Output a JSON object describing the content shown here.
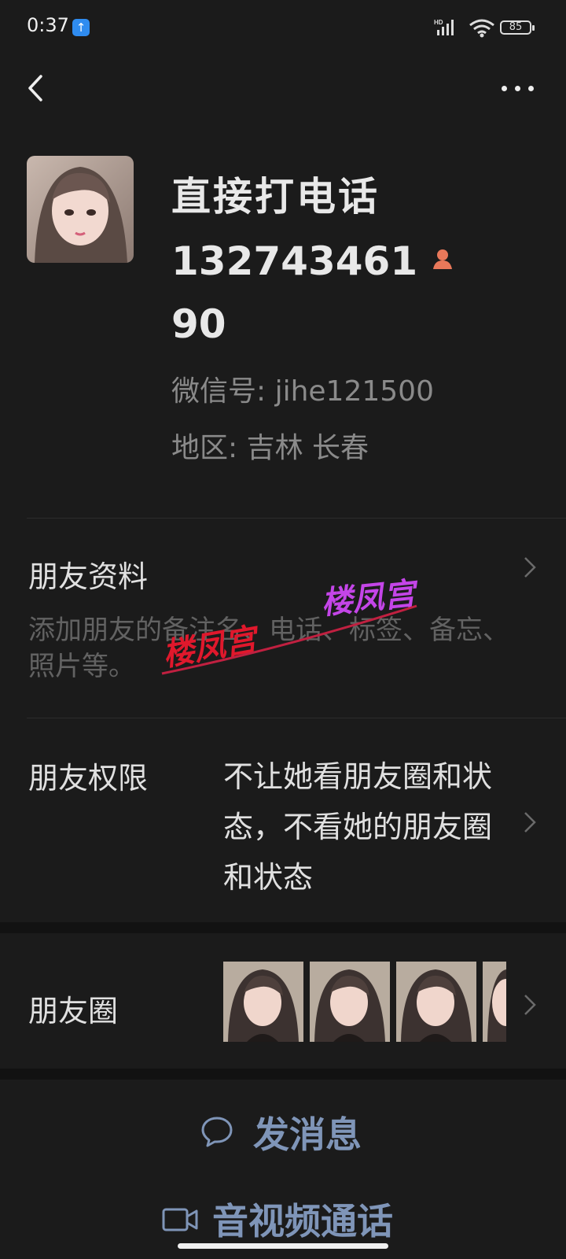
{
  "status_bar": {
    "time": "0:37",
    "upload_badge": "↑",
    "battery": "85"
  },
  "contact": {
    "name": "直接打电话",
    "phone": "13274346190",
    "wechat_id": "微信号: jihe121500",
    "region": "地区: 吉林  长春"
  },
  "friend_info": {
    "title": "朋友资料",
    "description": "添加朋友的备注名、电话、标签、备忘、照片等。"
  },
  "permissions": {
    "title": "朋友权限",
    "value": "不让她看朋友圈和状态，不看她的朋友圈和状态"
  },
  "moments": {
    "title": "朋友圈"
  },
  "actions": {
    "message": "发消息",
    "call": "音视频通话"
  },
  "watermark": "楼凤宫",
  "colors": {
    "background": "#1b1b1b",
    "accent_link": "#7f95b8",
    "gender_female": "#e8785a"
  }
}
